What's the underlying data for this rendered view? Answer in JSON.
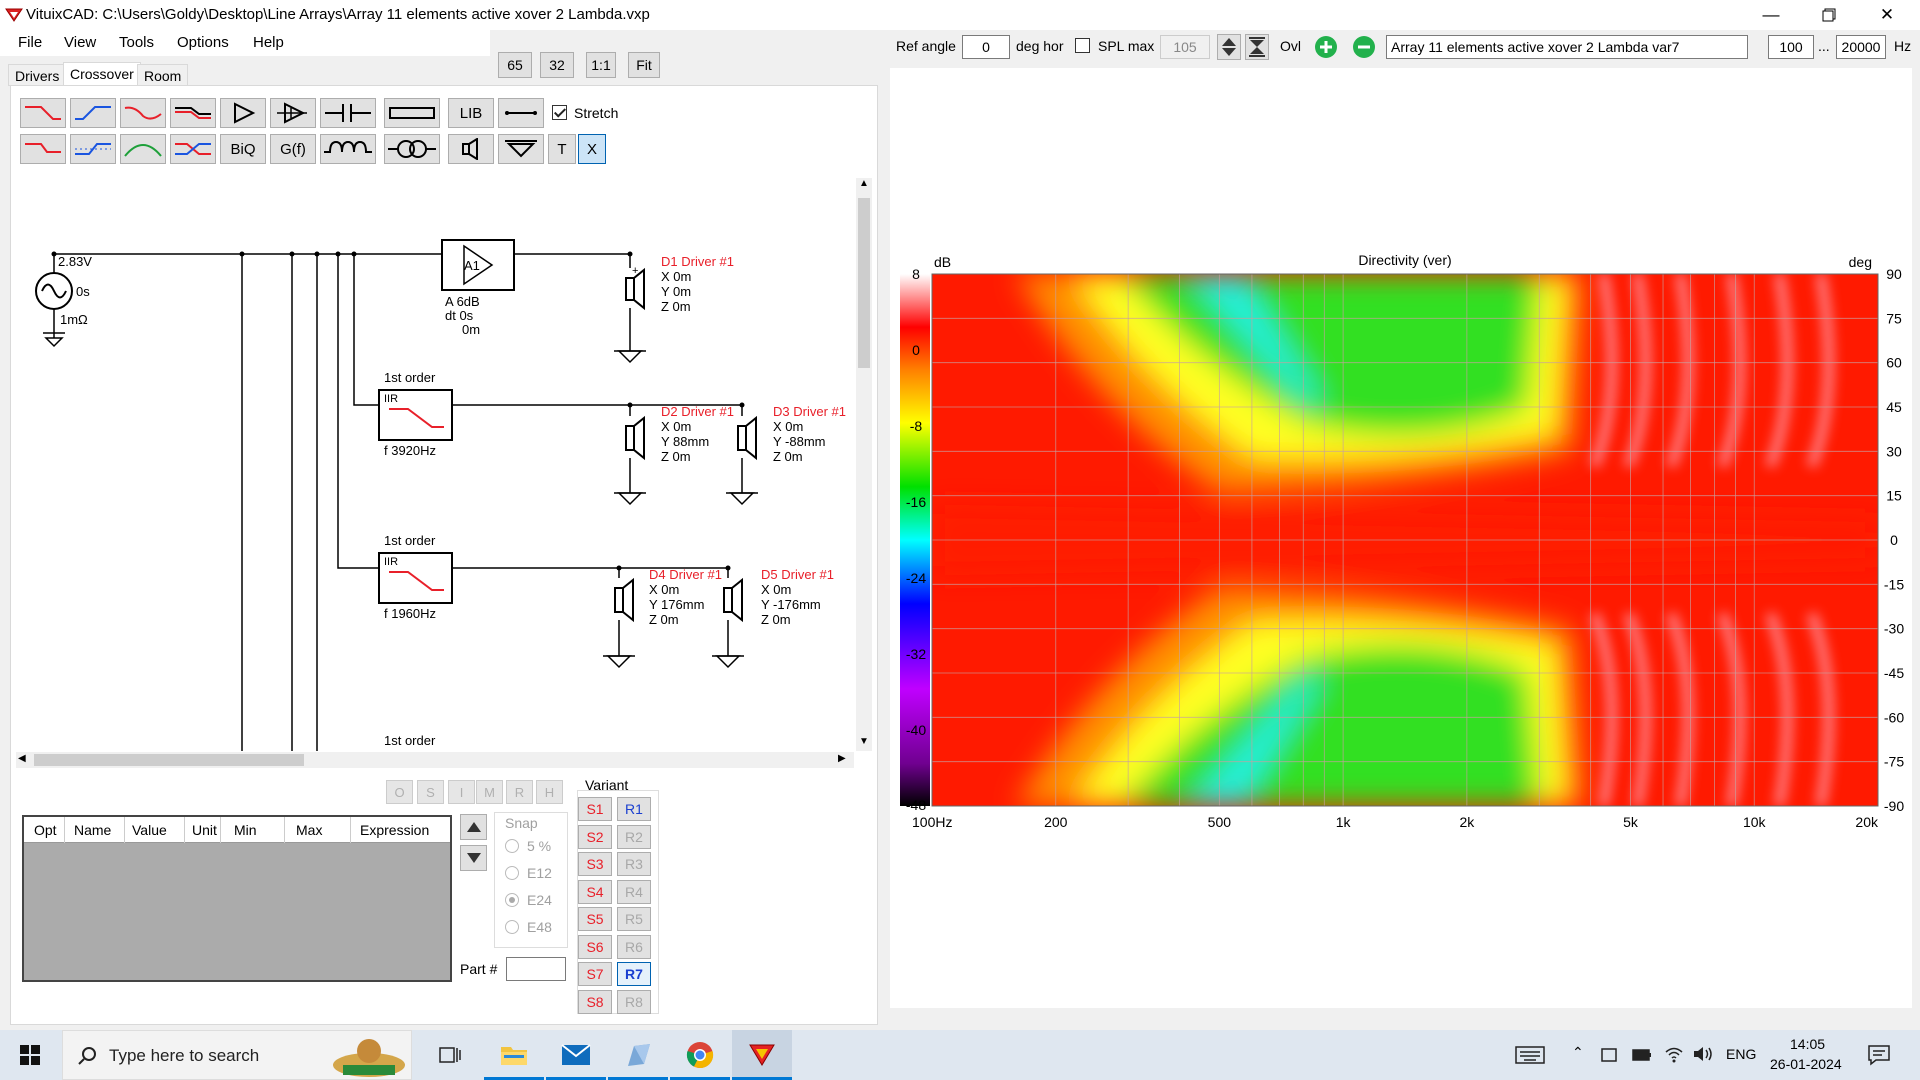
{
  "window": {
    "title": "VituixCAD: C:\\Users\\Goldy\\Desktop\\Line Arrays\\Array 11 elements active xover 2 Lambda.vxp"
  },
  "menu": [
    "File",
    "View",
    "Tools",
    "Options",
    "Help"
  ],
  "zoom_buttons": [
    "65",
    "32",
    "1:1",
    "Fit"
  ],
  "toolbar": {
    "ref_angle_label": "Ref angle",
    "ref_angle_value": "0",
    "deg_hor_label": "deg hor",
    "spl_max_label": "SPL max",
    "spl_max_value": "105",
    "ovl_label": "Ovl",
    "overlay_name": "Array 11 elements active xover 2 Lambda var7",
    "freq_min": "100",
    "ellipsis": "...",
    "freq_max": "20000",
    "hz_label": "Hz"
  },
  "tabs": [
    "Drivers",
    "Crossover",
    "Room"
  ],
  "components": {
    "lib": "LIB",
    "biq": "BiQ",
    "gf": "G(f)",
    "t": "T",
    "x": "X",
    "stretch_label": "Stretch"
  },
  "schematic": {
    "source": {
      "voltage": "2.83V",
      "delay": "0s",
      "resistance": "1mΩ"
    },
    "amp": {
      "name": "A1",
      "gain": "A  6dB",
      "dt": "dt 0s",
      "dist": "0m"
    },
    "filters": [
      {
        "order": "1st order",
        "type": "IIR",
        "freq": "f   3920Hz"
      },
      {
        "order": "1st order",
        "type": "IIR",
        "freq": "f   1960Hz"
      },
      {
        "order": "1st order"
      }
    ],
    "drivers": [
      {
        "name": "D1 Driver #1",
        "x": "X 0m",
        "y": "Y 0m",
        "z": "Z 0m"
      },
      {
        "name": "D2 Driver #1",
        "x": "X 0m",
        "y": "Y 88mm",
        "z": "Z 0m"
      },
      {
        "name": "D3 Driver #1",
        "x": "X 0m",
        "y": "Y -88mm",
        "z": "Z 0m"
      },
      {
        "name": "D4 Driver #1",
        "x": "X 0m",
        "y": "Y 176mm",
        "z": "Z 0m"
      },
      {
        "name": "D5 Driver #1",
        "x": "X 0m",
        "y": "Y -176mm",
        "z": "Z 0m"
      }
    ]
  },
  "opt_buttons": [
    "O",
    "S",
    "I",
    "M",
    "R",
    "H"
  ],
  "grid_columns": [
    "Opt",
    "Name",
    "Value",
    "Unit",
    "Min",
    "Max",
    "Expression"
  ],
  "snap": {
    "label": "Snap",
    "options": [
      "5 %",
      "E12",
      "E24",
      "E48"
    ],
    "selected": "E24"
  },
  "part_label": "Part #",
  "variant": {
    "label": "Variant",
    "s": [
      "S1",
      "S2",
      "S3",
      "S4",
      "S5",
      "S6",
      "S7",
      "S8"
    ],
    "r": [
      "R1",
      "R2",
      "R3",
      "R4",
      "R5",
      "R6",
      "R7",
      "R8"
    ],
    "active_s": "S7",
    "active_r": "R7"
  },
  "chart_data": {
    "type": "heatmap",
    "title": "Directivity (ver)",
    "left_unit": "dB",
    "right_unit": "deg",
    "colorbar_ticks": [
      "8",
      "0",
      "-8",
      "-16",
      "-24",
      "-32",
      "-40",
      "-48"
    ],
    "y_ticks": [
      "90",
      "75",
      "60",
      "45",
      "30",
      "15",
      "0",
      "-15",
      "-30",
      "-45",
      "-60",
      "-75",
      "-90"
    ],
    "x_ticks": [
      "100Hz",
      "200",
      "500",
      "1k",
      "2k",
      "5k",
      "10k",
      "20k"
    ],
    "x_range": [
      100,
      20000
    ],
    "y_range": [
      -90,
      90
    ],
    "color_range_db": [
      -48,
      8
    ],
    "x_scale": "log",
    "grid": true
  },
  "taskbar": {
    "search_placeholder": "Type here to search",
    "lang": "ENG",
    "time": "14:05",
    "date": "26-01-2024"
  }
}
